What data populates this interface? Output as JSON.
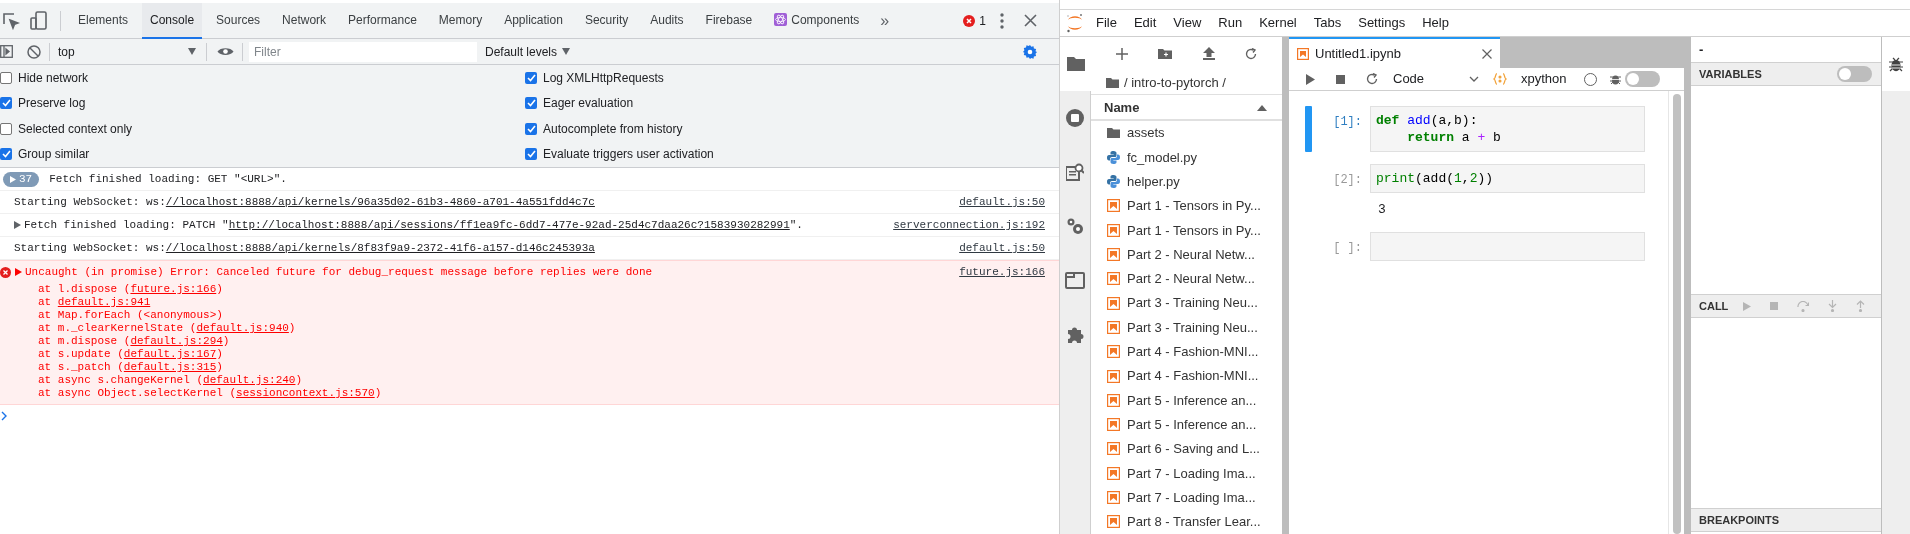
{
  "devtools": {
    "tabs": [
      {
        "label": "Elements",
        "selected": false,
        "kind": "plain"
      },
      {
        "label": "Console",
        "selected": true,
        "kind": "plain"
      },
      {
        "label": "Sources",
        "selected": false,
        "kind": "plain"
      },
      {
        "label": "Network",
        "selected": false,
        "kind": "plain"
      },
      {
        "label": "Performance",
        "selected": false,
        "kind": "plain"
      },
      {
        "label": "Memory",
        "selected": false,
        "kind": "plain"
      },
      {
        "label": "Application",
        "selected": false,
        "kind": "plain"
      },
      {
        "label": "Security",
        "selected": false,
        "kind": "plain"
      },
      {
        "label": "Audits",
        "selected": false,
        "kind": "plain"
      },
      {
        "label": "Firebase",
        "selected": false,
        "kind": "plain"
      },
      {
        "label": "Components",
        "selected": false,
        "kind": "react"
      }
    ],
    "more": "»",
    "error_count": "1",
    "context": "top",
    "filter_placeholder": "Filter",
    "levels": "Default levels",
    "settings_left": [
      {
        "label": "Hide network",
        "checked": false
      },
      {
        "label": "Preserve log",
        "checked": true
      },
      {
        "label": "Selected context only",
        "checked": false
      },
      {
        "label": "Group similar",
        "checked": true
      }
    ],
    "settings_right": [
      {
        "label": "Log XMLHttpRequests",
        "checked": true
      },
      {
        "label": "Eager evaluation",
        "checked": true
      },
      {
        "label": "Autocomplete from history",
        "checked": true
      },
      {
        "label": "Evaluate triggers user activation",
        "checked": true
      }
    ],
    "messages": [
      {
        "kind": "group",
        "count": "37",
        "expandable": false,
        "parts": [
          {
            "text": "Fetch finished loading: GET \"<URL>\".",
            "kind": "text"
          }
        ]
      },
      {
        "kind": "log",
        "expandable": false,
        "parts": [
          {
            "text": "Starting WebSocket: ws:",
            "kind": "text"
          },
          {
            "text": "//localhost:8888/api/kernels/96a35d02-61b3-4860-a701-4a551fdd4c7c",
            "kind": "link"
          }
        ],
        "source": "default.js:50"
      },
      {
        "kind": "log",
        "expandable": true,
        "parts": [
          {
            "text": "Fetch finished loading: PATCH \"",
            "kind": "text"
          },
          {
            "text": "http://localhost:8888/api/sessions/ff1ea9fc-6dd7-477e-92ad-25d4c7daa26c?1583930282991",
            "kind": "link"
          },
          {
            "text": "\".",
            "kind": "text"
          }
        ],
        "source": "serverconnection.js:192"
      },
      {
        "kind": "log",
        "expandable": false,
        "parts": [
          {
            "text": "Starting WebSocket: ws:",
            "kind": "text"
          },
          {
            "text": "//localhost:8888/api/kernels/8f83f9a9-2372-41f6-a157-d146c245393a",
            "kind": "link"
          }
        ],
        "source": "default.js:50"
      },
      {
        "kind": "error",
        "expandable": true,
        "parts": [
          {
            "text": "Uncaught (in promise) Error: Canceled future for debug_request message before replies were done",
            "kind": "text"
          }
        ],
        "source": "future.js:166",
        "stack": [
          [
            {
              "text": "at l.dispose (",
              "kind": "text"
            },
            {
              "text": "future.js:166",
              "kind": "link"
            },
            {
              "text": ")",
              "kind": "text"
            }
          ],
          [
            {
              "text": "at ",
              "kind": "text"
            },
            {
              "text": "default.js:941",
              "kind": "link"
            }
          ],
          [
            {
              "text": "at Map.forEach (<anonymous>)",
              "kind": "text"
            }
          ],
          [
            {
              "text": "at m._clearKernelState (",
              "kind": "text"
            },
            {
              "text": "default.js:940",
              "kind": "link"
            },
            {
              "text": ")",
              "kind": "text"
            }
          ],
          [
            {
              "text": "at m.dispose (",
              "kind": "text"
            },
            {
              "text": "default.js:294",
              "kind": "link"
            },
            {
              "text": ")",
              "kind": "text"
            }
          ],
          [
            {
              "text": "at s.update (",
              "kind": "text"
            },
            {
              "text": "default.js:167",
              "kind": "link"
            },
            {
              "text": ")",
              "kind": "text"
            }
          ],
          [
            {
              "text": "at s._patch (",
              "kind": "text"
            },
            {
              "text": "default.js:315",
              "kind": "link"
            },
            {
              "text": ")",
              "kind": "text"
            }
          ],
          [
            {
              "text": "at async s.changeKernel (",
              "kind": "text"
            },
            {
              "text": "default.js:240",
              "kind": "link"
            },
            {
              "text": ")",
              "kind": "text"
            }
          ],
          [
            {
              "text": "at async Object.selectKernel (",
              "kind": "text"
            },
            {
              "text": "sessioncontext.js:570",
              "kind": "link"
            },
            {
              "text": ")",
              "kind": "text"
            }
          ]
        ]
      }
    ]
  },
  "jupyter": {
    "menu": [
      "File",
      "Edit",
      "View",
      "Run",
      "Kernel",
      "Tabs",
      "Settings",
      "Help"
    ],
    "side_tabs": [
      {
        "kind": "files",
        "selected": true
      },
      {
        "kind": "running",
        "selected": false
      },
      {
        "kind": "commands",
        "selected": false
      },
      {
        "kind": "tools",
        "selected": false
      },
      {
        "kind": "tabs",
        "selected": false
      },
      {
        "kind": "extensions",
        "selected": false
      }
    ],
    "file_browser": {
      "path": "/ intro-to-pytorch /",
      "column": "Name",
      "items": [
        {
          "kind": "folder",
          "name": "assets"
        },
        {
          "kind": "python",
          "name": "fc_model.py"
        },
        {
          "kind": "python",
          "name": "helper.py"
        },
        {
          "kind": "notebook",
          "name": "Part 1 - Tensors in Py..."
        },
        {
          "kind": "notebook",
          "name": "Part 1 - Tensors in Py..."
        },
        {
          "kind": "notebook",
          "name": "Part 2 - Neural Netw..."
        },
        {
          "kind": "notebook",
          "name": "Part 2 - Neural Netw..."
        },
        {
          "kind": "notebook",
          "name": "Part 3 - Training Neu..."
        },
        {
          "kind": "notebook",
          "name": "Part 3 - Training Neu..."
        },
        {
          "kind": "notebook",
          "name": "Part 4 - Fashion-MNI..."
        },
        {
          "kind": "notebook",
          "name": "Part 4 - Fashion-MNI..."
        },
        {
          "kind": "notebook",
          "name": "Part 5 - Inference an..."
        },
        {
          "kind": "notebook",
          "name": "Part 5 - Inference an..."
        },
        {
          "kind": "notebook",
          "name": "Part 6 - Saving and L..."
        },
        {
          "kind": "notebook",
          "name": "Part 7 - Loading Ima..."
        },
        {
          "kind": "notebook",
          "name": "Part 7 - Loading Ima..."
        },
        {
          "kind": "notebook",
          "name": "Part 8 - Transfer Lear..."
        }
      ]
    },
    "notebook": {
      "tab": {
        "title": "Untitled1.ipynb"
      },
      "cell_type": "Code",
      "kernel": "xpython",
      "kernel_busy": false,
      "debugger_on": false,
      "cells": [
        {
          "prompt": "[1]:",
          "active": true,
          "lines": [
            [
              {
                "kind": "keyword",
                "text": "def"
              },
              {
                "kind": "function",
                "text": " add"
              },
              {
                "kind": "plain",
                "text": "(a,b):"
              }
            ],
            [
              {
                "kind": "keyword",
                "text": "    return"
              },
              {
                "kind": "plain",
                "text": " a "
              },
              {
                "kind": "operator",
                "text": "+"
              },
              {
                "kind": "plain",
                "text": " b"
              }
            ]
          ]
        },
        {
          "prompt": "[2]:",
          "active": false,
          "lines": [
            [
              {
                "kind": "builtin",
                "text": "print"
              },
              {
                "kind": "plain",
                "text": "(add("
              },
              {
                "kind": "number",
                "text": "1"
              },
              {
                "kind": "plain",
                "text": ","
              },
              {
                "kind": "number",
                "text": "2"
              },
              {
                "kind": "plain",
                "text": "))"
              }
            ]
          ],
          "output": "3"
        },
        {
          "prompt": "[ ]:",
          "active": false
        }
      ]
    },
    "debugger": {
      "title": "-",
      "sections": [
        {
          "kind": "variables",
          "label": "VARIABLES",
          "toggle_on": false
        },
        {
          "kind": "callstack",
          "label": "CALL"
        },
        {
          "kind": "breakpoints",
          "label": "BREAKPOINTS"
        }
      ]
    }
  }
}
